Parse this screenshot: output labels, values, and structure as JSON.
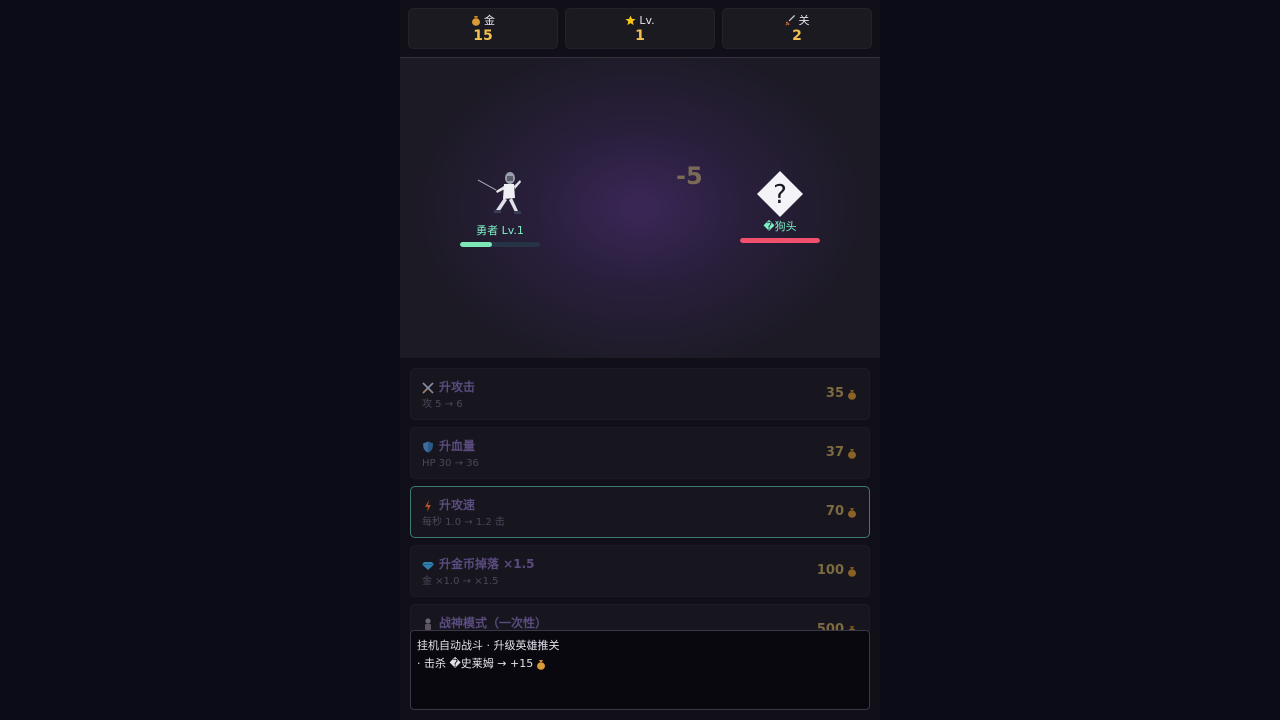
{
  "stats": [
    {
      "icon": "money-bag-icon",
      "label": "金",
      "value": "15"
    },
    {
      "icon": "star-icon",
      "label": "Lv.",
      "value": "1"
    },
    {
      "icon": "dagger-icon",
      "label": "关",
      "value": "2"
    }
  ],
  "hero": {
    "name": "勇者 Lv.1",
    "hp_fraction": 0.4,
    "hp_color": "#7be8b6"
  },
  "enemy": {
    "name": "�狗头",
    "hp_fraction": 1.0,
    "hp_color": "#f0506c"
  },
  "damage_text": "-5",
  "upgrades": [
    {
      "icon": "crossed-swords-icon",
      "title": "升攻击",
      "desc": "攻 5 → 6",
      "cost": "35"
    },
    {
      "icon": "shield-icon",
      "title": "升血量",
      "desc": "HP 30 → 36",
      "cost": "37"
    },
    {
      "icon": "lightning-icon",
      "title": "升攻速",
      "desc": "每秒 1.0 → 1.2 击",
      "cost": "70"
    },
    {
      "icon": "gem-icon",
      "title": "升金币掉落 ×1.5",
      "desc": "金 ×1.0 → ×1.5",
      "cost": "100"
    },
    {
      "icon": "warrior-icon",
      "title": "战神模式（一次性）",
      "desc": "",
      "cost": "500"
    }
  ],
  "log": {
    "lines": [
      "挂机自动战斗 · 升级英雄推关",
      "· 击杀 �史莱姆 → +15"
    ]
  },
  "colors": {
    "gold": "#f2c14e",
    "accent_name": "#7df0c4",
    "selected_border": "#3e7a74"
  }
}
